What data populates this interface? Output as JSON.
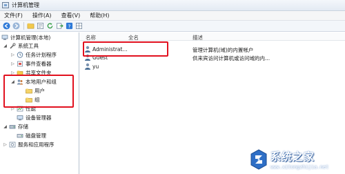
{
  "window": {
    "title": "计算机管理"
  },
  "menu": {
    "items": [
      "文件(F)",
      "操作(A)",
      "查看(V)",
      "帮助(H)"
    ]
  },
  "toolbar": {
    "icons": [
      "back-arrow-icon",
      "forward-arrow-icon",
      "folder-up-icon",
      "properties-icon",
      "refresh-icon",
      "export-icon",
      "help-icon",
      "grid-icon"
    ]
  },
  "tree": {
    "root": "计算机管理(本地)",
    "system_tools": "系统工具",
    "task_scheduler": "任务计划程序",
    "event_viewer": "事件查看器",
    "shared_folders": "共享文件夹",
    "local_users_groups": "本地用户和组",
    "users": "用户",
    "groups": "组",
    "performance": "性能",
    "device_manager": "设备管理器",
    "storage": "存储",
    "disk_management": "磁盘管理",
    "services_apps": "服务和应用程序"
  },
  "list": {
    "columns": {
      "name": "名称",
      "full_name": "全名",
      "description": "描述"
    },
    "rows": [
      {
        "name": "Administrat...",
        "full_name": "",
        "description": "管理计算机(域)的内置帐户"
      },
      {
        "name": "Guest",
        "full_name": "",
        "description": "供来宾访问计算机或访问域的内..."
      },
      {
        "name": "yu",
        "full_name": "",
        "description": ""
      }
    ]
  },
  "watermark": {
    "name": "系统之家",
    "url": "www.xitongzhijia.net"
  },
  "colors": {
    "highlight": "#e1101e",
    "accent": "#3a6fb8"
  }
}
